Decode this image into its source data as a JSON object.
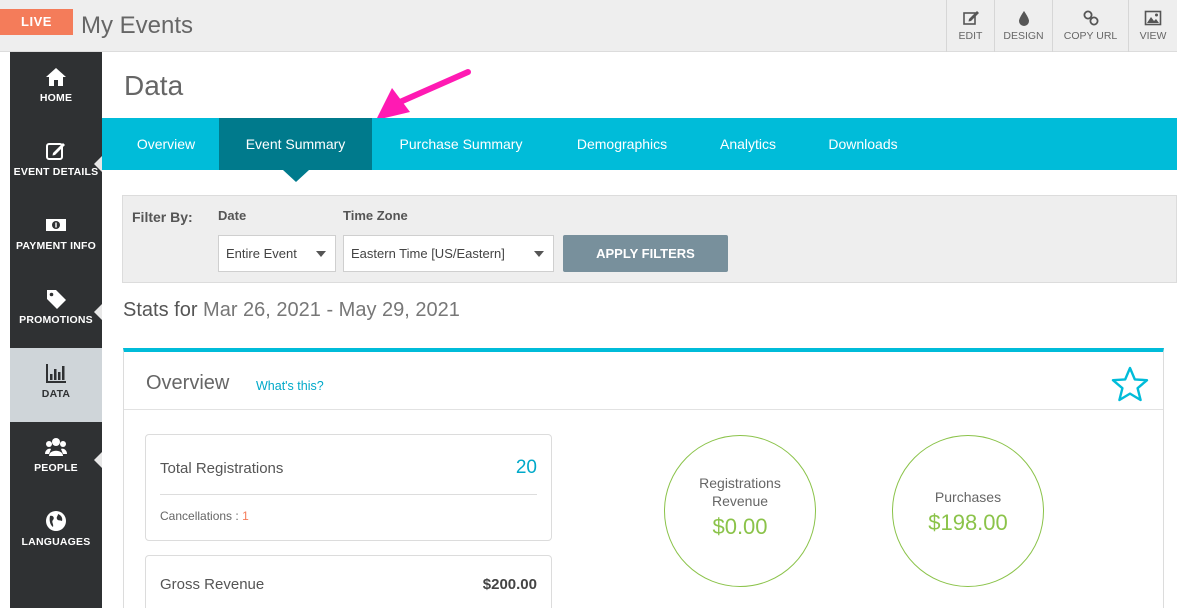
{
  "topbar": {
    "badge": "LIVE",
    "title": "My Events",
    "tools": [
      {
        "label": "EDIT",
        "icon": "edit-icon"
      },
      {
        "label": "DESIGN",
        "icon": "droplet-icon"
      },
      {
        "label": "COPY URL",
        "icon": "link-icon"
      },
      {
        "label": "VIEW",
        "icon": "image-icon"
      }
    ]
  },
  "sidebar": {
    "items": [
      {
        "label": "HOME",
        "icon": "home-icon"
      },
      {
        "label": "EVENT DETAILS",
        "icon": "edit-icon"
      },
      {
        "label": "PAYMENT INFO",
        "icon": "banknote-icon"
      },
      {
        "label": "PROMOTIONS",
        "icon": "tag-icon"
      },
      {
        "label": "DATA",
        "icon": "bar-chart-icon"
      },
      {
        "label": "PEOPLE",
        "icon": "people-icon"
      },
      {
        "label": "LANGUAGES",
        "icon": "globe-icon"
      }
    ]
  },
  "main": {
    "title": "Data",
    "tabs": [
      {
        "label": "Overview"
      },
      {
        "label": "Event Summary"
      },
      {
        "label": "Purchase Summary"
      },
      {
        "label": "Demographics"
      },
      {
        "label": "Analytics"
      },
      {
        "label": "Downloads"
      }
    ],
    "filter": {
      "heading": "Filter By:",
      "date_label": "Date",
      "date_value": "Entire Event",
      "timezone_label": "Time Zone",
      "timezone_value": "Eastern Time [US/Eastern]",
      "apply_label": "APPLY FILTERS"
    },
    "stats": {
      "prefix": "Stats for",
      "range": "Mar 26, 2021 - May 29, 2021"
    },
    "overview": {
      "title": "Overview",
      "help_link": "What's this?",
      "total_registrations_label": "Total Registrations",
      "total_registrations_value": "20",
      "cancellations_label": "Cancellations :",
      "cancellations_value": "1",
      "gross_revenue_label": "Gross Revenue",
      "gross_revenue_value": "$200.00",
      "registrations_revenue_label_1": "Registrations",
      "registrations_revenue_label_2": "Revenue",
      "registrations_revenue_value": "$0.00",
      "purchases_label": "Purchases",
      "purchases_value": "$198.00"
    }
  },
  "colors": {
    "accent": "#00bcd9",
    "active_tab": "#007a8c",
    "live_badge": "#f47c5a",
    "sidebar": "#2f3133",
    "positive": "#8bc34a",
    "annotation_arrow": "#ff1ab3"
  }
}
